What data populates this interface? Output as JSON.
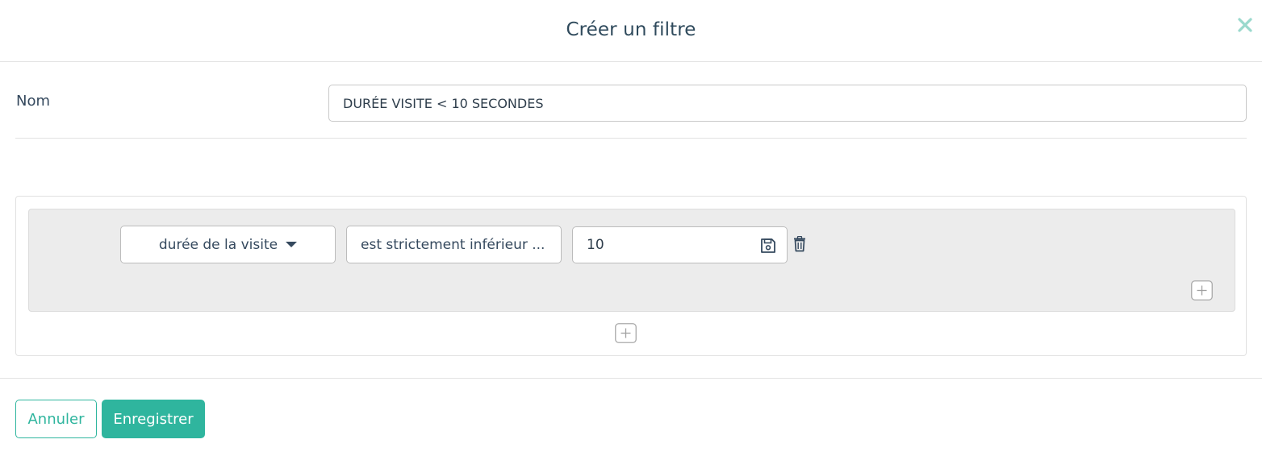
{
  "dialog": {
    "title": "Créer un filtre",
    "close_icon": "close-icon"
  },
  "name_field": {
    "label": "Nom",
    "value": "DURÉE VISITE < 10 SECONDES"
  },
  "rule": {
    "field": "durée de la visite",
    "operator": "est strictement inférieur ...",
    "value": "10",
    "icons": [
      "chevron-down-icon",
      "save-icon",
      "trash-icon"
    ]
  },
  "actions": {
    "add_rule_icon": "plus-icon",
    "add_group_icon": "plus-icon",
    "cancel_label": "Annuler",
    "save_label": "Enregistrer"
  },
  "colors": {
    "accent": "#2fb59e",
    "text": "#35495e",
    "group_background": "#ececec",
    "close_icon": "#9ad9cd"
  }
}
